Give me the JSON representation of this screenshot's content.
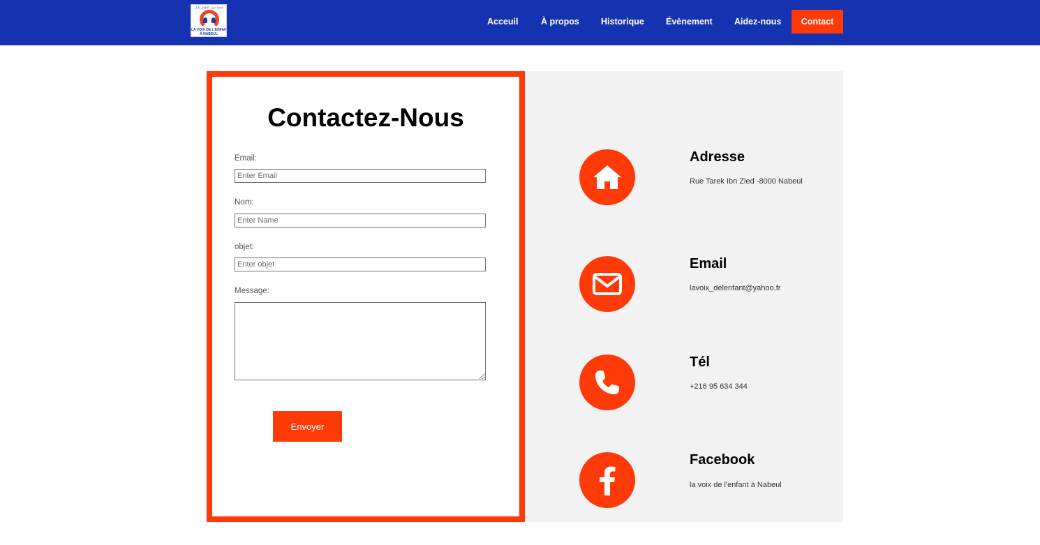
{
  "logo": {
    "arabic_text": "جمعية صوت الطفل بنابل",
    "line1": "LA VOIX DE L'ENFANT",
    "line2": "À NABEUL"
  },
  "nav": {
    "items": [
      "Acceuil",
      "À propos",
      "Historique",
      "Évènement",
      "Aidez-nous"
    ],
    "active": "Contact"
  },
  "form": {
    "title": "Contactez-Nous",
    "email_label": "Email:",
    "email_placeholder": "Enter Email",
    "name_label": "Nom:",
    "name_placeholder": "Enter Name",
    "subject_label": "objet:",
    "subject_placeholder": "Enter objet",
    "message_label": "Message:",
    "submit_label": "Envoyer"
  },
  "info": [
    {
      "icon": "home-icon",
      "title": "Adresse",
      "text": "Rue Tarek Ibn Zied -8000 Nabeul"
    },
    {
      "icon": "envelope-icon",
      "title": "Email",
      "text": "lavoix_delenfant@yahoo.fr"
    },
    {
      "icon": "phone-icon",
      "title": "Tél",
      "text": "+216 95 634 344"
    },
    {
      "icon": "facebook-icon",
      "title": "Facebook",
      "text": "la voix de l'enfant à Nabeul"
    }
  ],
  "colors": {
    "header_bg": "#1533b0",
    "accent": "#fe3a09",
    "info_bg": "#f2f2f2"
  }
}
